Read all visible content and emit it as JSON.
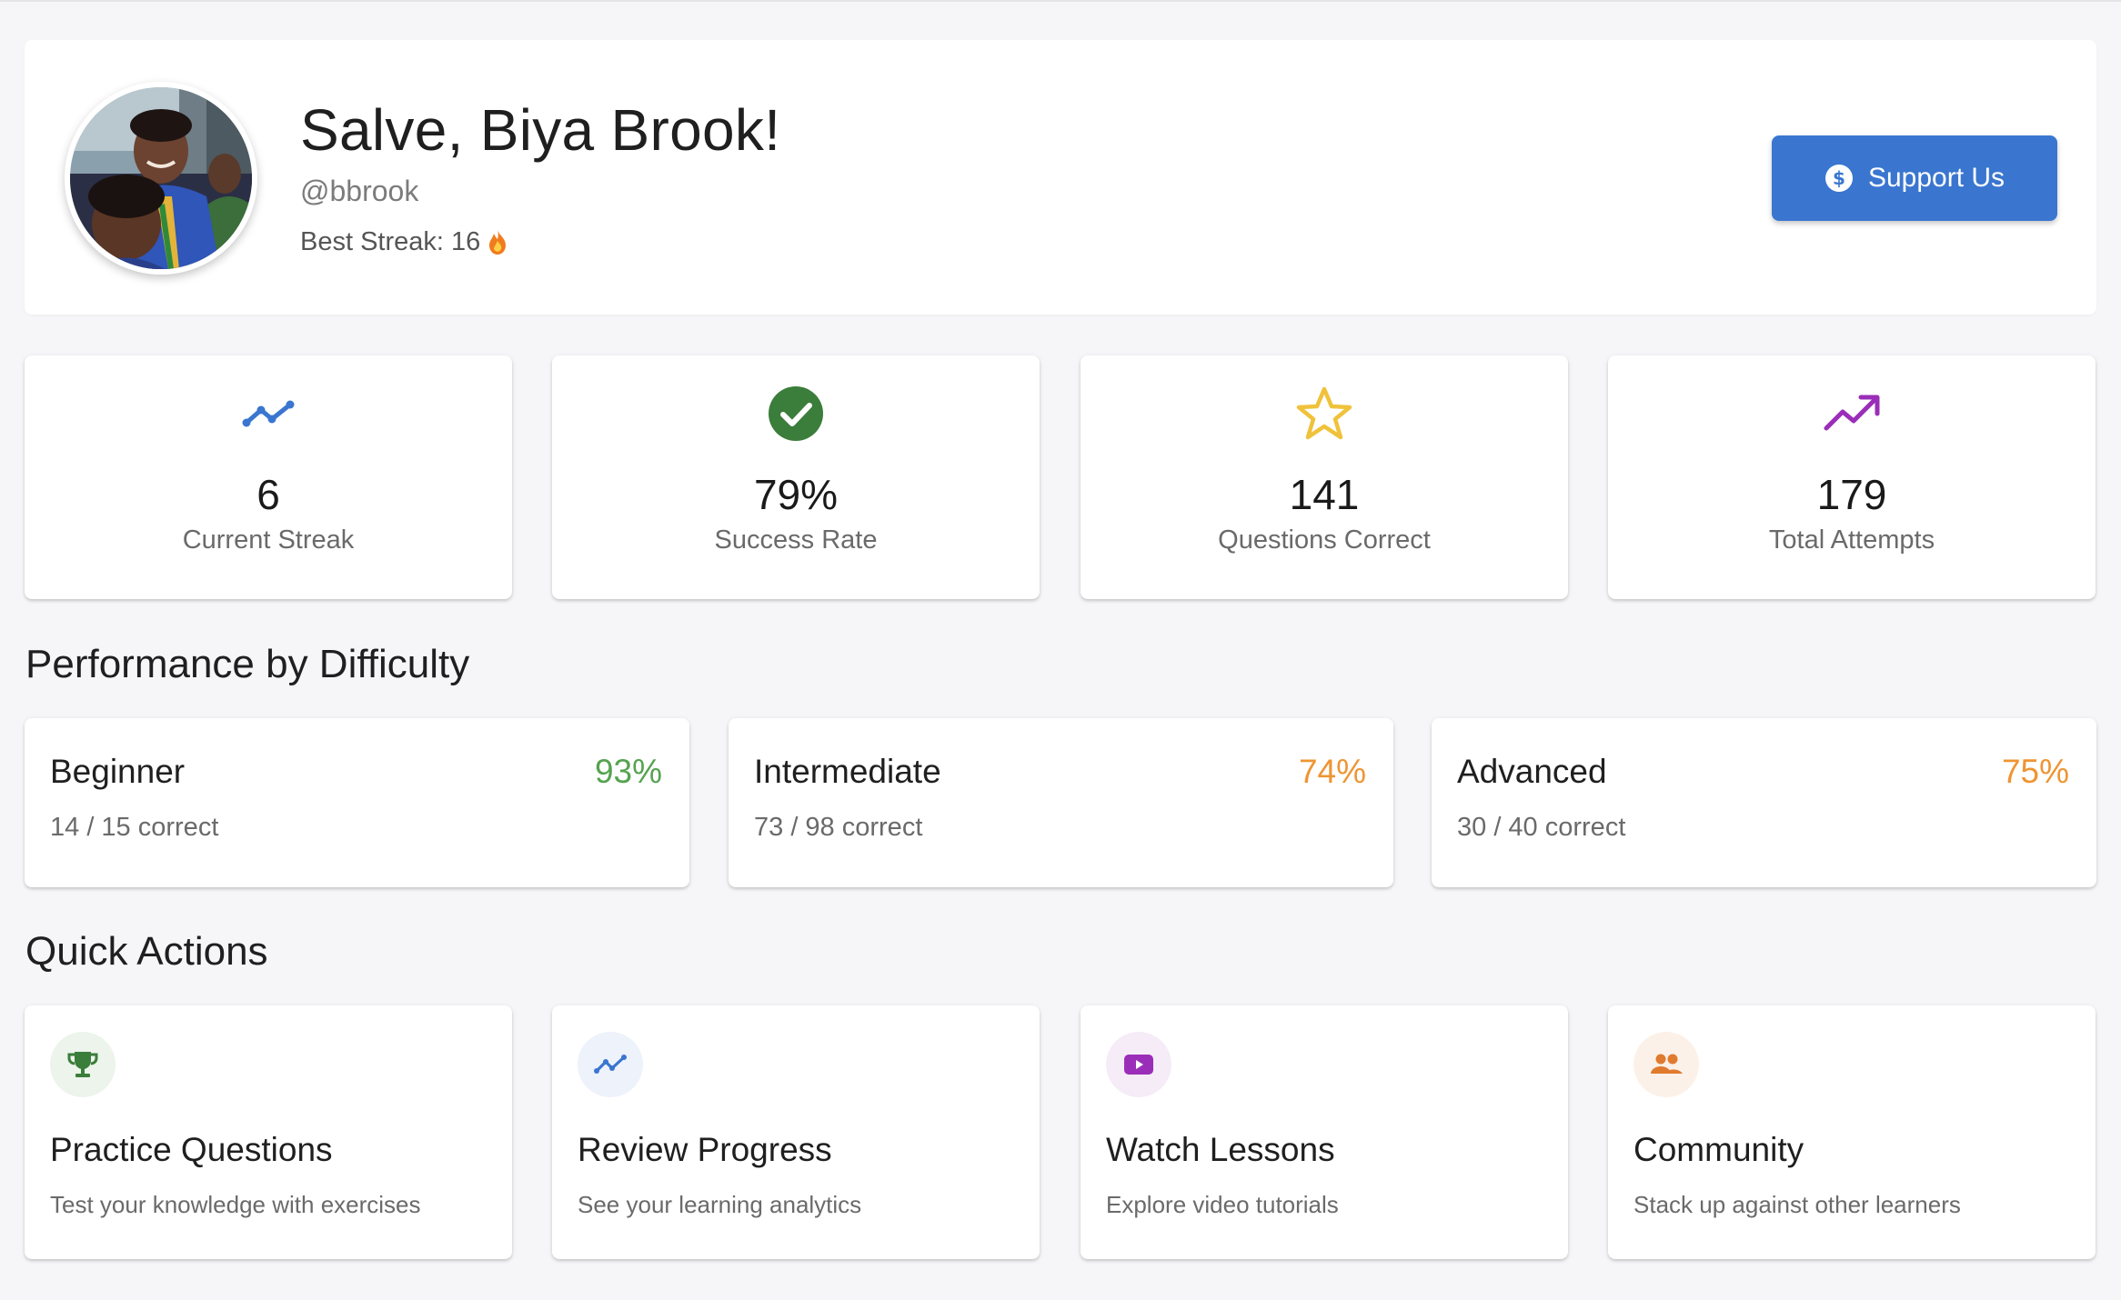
{
  "profile": {
    "greeting": "Salve, Biya Brook!",
    "handle": "@bbrook",
    "best_streak": "Best Streak: 16",
    "support_label": "Support Us",
    "accent": "#3a76d0"
  },
  "stats": [
    {
      "value": "6",
      "label": "Current Streak",
      "icon": "timeline-icon",
      "color": "#3a76d0"
    },
    {
      "value": "79%",
      "label": "Success Rate",
      "icon": "check-circle-icon",
      "color": "#3b7d3a"
    },
    {
      "value": "141",
      "label": "Questions Correct",
      "icon": "star-outline-icon",
      "color": "#f0c23b"
    },
    {
      "value": "179",
      "label": "Total Attempts",
      "icon": "trending-up-icon",
      "color": "#9a2eb8"
    }
  ],
  "performance": {
    "title": "Performance by Difficulty",
    "items": [
      {
        "name": "Beginner",
        "percent": "93%",
        "detail": "14 / 15 correct",
        "color": "#55a34f"
      },
      {
        "name": "Intermediate",
        "percent": "74%",
        "detail": "73 / 98 correct",
        "color": "#ee9533"
      },
      {
        "name": "Advanced",
        "percent": "75%",
        "detail": "30 / 40 correct",
        "color": "#ee9533"
      }
    ]
  },
  "quick_actions": {
    "title": "Quick Actions",
    "items": [
      {
        "title": "Practice Questions",
        "desc": "Test your knowledge with exercises",
        "icon": "trophy-icon",
        "color": "#3b7d3a",
        "bg": "#ecf4ec"
      },
      {
        "title": "Review Progress",
        "desc": "See your learning analytics",
        "icon": "timeline-icon",
        "color": "#3a76d0",
        "bg": "#edf2fb"
      },
      {
        "title": "Watch Lessons",
        "desc": "Explore video tutorials",
        "icon": "video-play-icon",
        "color": "#9a2eb8",
        "bg": "#f5ecf8"
      },
      {
        "title": "Community",
        "desc": "Stack up against other learners",
        "icon": "people-icon",
        "color": "#e07a2e",
        "bg": "#fcf1e8"
      }
    ]
  }
}
